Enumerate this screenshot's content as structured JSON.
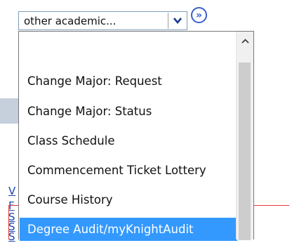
{
  "select": {
    "value": "other academic...",
    "go_icon": "double-chevron-right-icon"
  },
  "dropdown": {
    "items": [
      {
        "label": "Change Major: Request"
      },
      {
        "label": "Change Major: Status"
      },
      {
        "label": "Class Schedule"
      },
      {
        "label": "Commencement Ticket Lottery"
      },
      {
        "label": "Course History"
      },
      {
        "label": "Degree Audit/myKnightAudit",
        "selected": true
      }
    ]
  },
  "background_fragments": [
    "V",
    "F",
    "S",
    "S",
    "S"
  ],
  "colors": {
    "selection": "#3399ff",
    "border": "#7f9db9",
    "link": "#1a45b0",
    "highlight_line": "#e23b3b"
  }
}
